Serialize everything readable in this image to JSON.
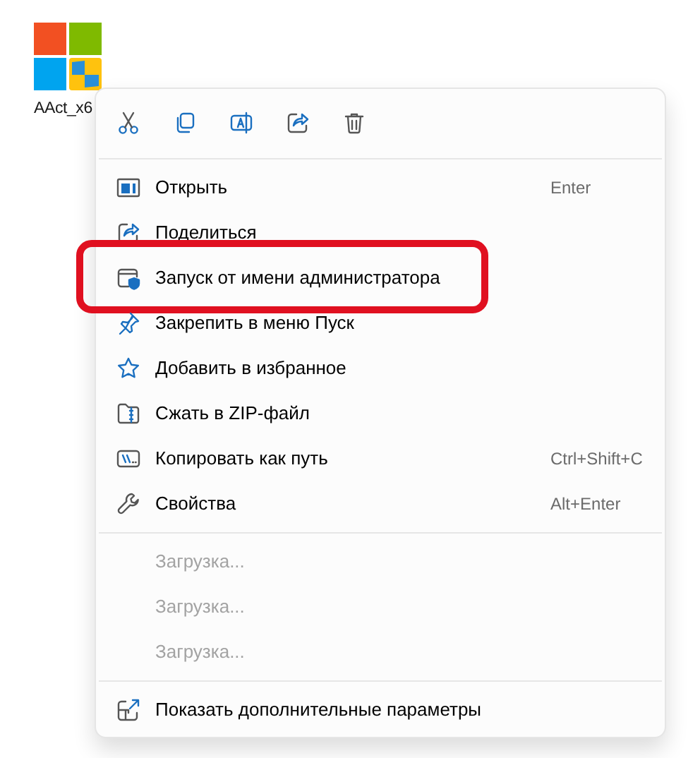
{
  "desktop_icon": {
    "label": "AAct_x6"
  },
  "menu_items": [
    {
      "label": "Открыть",
      "shortcut": "Enter",
      "highlighted": false
    },
    {
      "label": "Поделиться",
      "highlighted": false
    },
    {
      "label": "Запуск от имени администратора",
      "highlighted": true
    },
    {
      "label": "Закрепить в меню Пуск",
      "highlighted": false
    },
    {
      "label": "Добавить в избранное",
      "highlighted": false
    },
    {
      "label": "Сжать в ZIP-файл",
      "highlighted": false
    },
    {
      "label": "Копировать как путь",
      "shortcut": "Ctrl+Shift+C",
      "highlighted": false
    },
    {
      "label": "Свойства",
      "shortcut": "Alt+Enter",
      "highlighted": false
    }
  ],
  "loading_items": [
    {
      "label": "Загрузка...",
      "disabled": true
    },
    {
      "label": "Загрузка...",
      "disabled": true
    },
    {
      "label": "Загрузка...",
      "disabled": true
    }
  ],
  "footer_item": {
    "label": "Показать дополнительные параметры"
  }
}
